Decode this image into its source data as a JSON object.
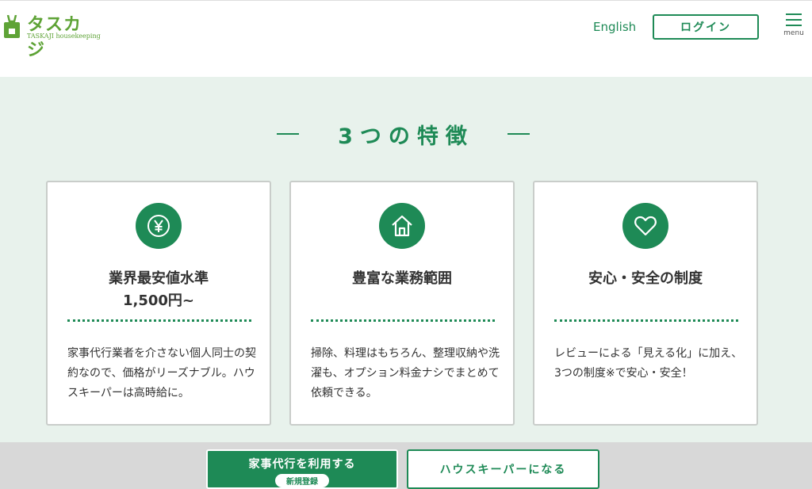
{
  "header": {
    "logo_text": "タスカジ",
    "logo_subtext": "TASKAJI housekeeping",
    "language_link": "English",
    "login_label": "ログイン",
    "menu_label": "menu"
  },
  "features": {
    "title": "3つの特徴",
    "cards": [
      {
        "icon": "yen-icon",
        "title": "業界最安値水準",
        "subtitle": "1,500円~",
        "text": "家事代行業者を介さない個人同士の契約なので、価格がリーズナブル。ハウスキーパーは高時給に。"
      },
      {
        "icon": "house-icon",
        "title": "豊富な業務範囲",
        "subtitle": "",
        "text": "掃除、料理はもちろん、整理収納や洗濯も、オプション料金ナシでまとめて依頼できる。"
      },
      {
        "icon": "heart-icon",
        "title": "安心・安全の制度",
        "subtitle": "",
        "text": "レビューによる「見える化」に加え、3つの制度※で安心・安全！"
      }
    ]
  },
  "footer_cta": {
    "primary_label": "家事代行を利用する",
    "primary_badge": "新規登録",
    "secondary_label": "ハウスキーパーになる"
  },
  "colors": {
    "brand_green": "#1e8a56",
    "logo_green": "#5ea336",
    "section_bg": "#e8f2ec"
  }
}
